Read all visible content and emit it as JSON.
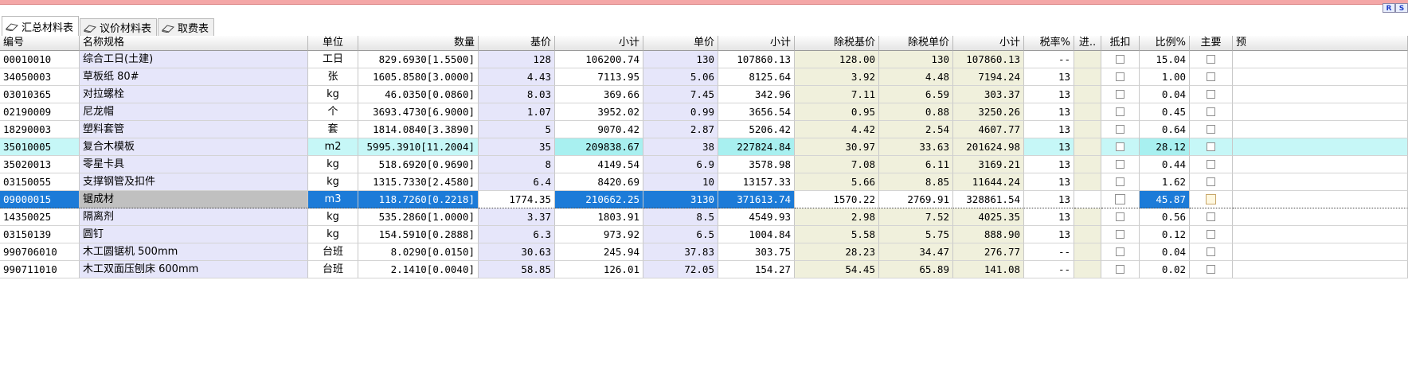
{
  "ribbon_badges": [
    "R",
    "S"
  ],
  "tabs": [
    {
      "label": "汇总材料表",
      "icon": "book-icon",
      "active": true
    },
    {
      "label": "议价材料表",
      "icon": "book-icon",
      "active": false
    },
    {
      "label": "取费表",
      "icon": "book-icon",
      "active": false
    }
  ],
  "columns": [
    "编号",
    "名称规格",
    "单位",
    "数量",
    "基价",
    "小计",
    "单价",
    "小计",
    "除税基价",
    "除税单价",
    "小计",
    "税率%",
    "进..",
    "抵扣",
    "比例%",
    "主要",
    "预"
  ],
  "rows": [
    {
      "code": "00010010",
      "name": "综合工日(土建)",
      "unit": "工日",
      "qty": "829.6930[1.5500]",
      "base_price": "128",
      "subtotal1": "106200.74",
      "unit_price": "130",
      "subtotal2": "107860.13",
      "tax_free_base": "128.00",
      "tax_free_unit": "130",
      "subtotal3": "107860.13",
      "tax_rate": "--",
      "ratio": "15.04"
    },
    {
      "code": "34050003",
      "name": "草板纸 80#",
      "unit": "张",
      "qty": "1605.8580[3.0000]",
      "base_price": "4.43",
      "subtotal1": "7113.95",
      "unit_price": "5.06",
      "subtotal2": "8125.64",
      "tax_free_base": "3.92",
      "tax_free_unit": "4.48",
      "subtotal3": "7194.24",
      "tax_rate": "13",
      "ratio": "1.00"
    },
    {
      "code": "03010365",
      "name": "对拉螺栓",
      "unit": "kg",
      "qty": "46.0350[0.0860]",
      "base_price": "8.03",
      "subtotal1": "369.66",
      "unit_price": "7.45",
      "subtotal2": "342.96",
      "tax_free_base": "7.11",
      "tax_free_unit": "6.59",
      "subtotal3": "303.37",
      "tax_rate": "13",
      "ratio": "0.04"
    },
    {
      "code": "02190009",
      "name": "尼龙帽",
      "unit": "个",
      "qty": "3693.4730[6.9000]",
      "base_price": "1.07",
      "subtotal1": "3952.02",
      "unit_price": "0.99",
      "subtotal2": "3656.54",
      "tax_free_base": "0.95",
      "tax_free_unit": "0.88",
      "subtotal3": "3250.26",
      "tax_rate": "13",
      "ratio": "0.45"
    },
    {
      "code": "18290003",
      "name": "塑料套管",
      "unit": "套",
      "qty": "1814.0840[3.3890]",
      "base_price": "5",
      "subtotal1": "9070.42",
      "unit_price": "2.87",
      "subtotal2": "5206.42",
      "tax_free_base": "4.42",
      "tax_free_unit": "2.54",
      "subtotal3": "4607.77",
      "tax_rate": "13",
      "ratio": "0.64"
    },
    {
      "code": "35010005",
      "name": "复合木模板",
      "unit": "m2",
      "qty": "5995.3910[11.2004]",
      "base_price": "35",
      "subtotal1": "209838.67",
      "unit_price": "38",
      "subtotal2": "227824.84",
      "tax_free_base": "30.97",
      "tax_free_unit": "33.63",
      "subtotal3": "201624.98",
      "tax_rate": "13",
      "ratio": "28.12"
    },
    {
      "code": "35020013",
      "name": "零星卡具",
      "unit": "kg",
      "qty": "518.6920[0.9690]",
      "base_price": "8",
      "subtotal1": "4149.54",
      "unit_price": "6.9",
      "subtotal2": "3578.98",
      "tax_free_base": "7.08",
      "tax_free_unit": "6.11",
      "subtotal3": "3169.21",
      "tax_rate": "13",
      "ratio": "0.44"
    },
    {
      "code": "03150055",
      "name": "支撑钢管及扣件",
      "unit": "kg",
      "qty": "1315.7330[2.4580]",
      "base_price": "6.4",
      "subtotal1": "8420.69",
      "unit_price": "10",
      "subtotal2": "13157.33",
      "tax_free_base": "5.66",
      "tax_free_unit": "8.85",
      "subtotal3": "11644.24",
      "tax_rate": "13",
      "ratio": "1.62"
    },
    {
      "code": "09000015",
      "name": "锯成材",
      "unit": "m3",
      "qty": "118.7260[0.2218]",
      "base_price": "1774.35",
      "subtotal1": "210662.25",
      "unit_price": "3130",
      "subtotal2": "371613.74",
      "tax_free_base": "1570.22",
      "tax_free_unit": "2769.91",
      "subtotal3": "328861.54",
      "tax_rate": "13",
      "ratio": "45.87"
    },
    {
      "code": "14350025",
      "name": "隔离剂",
      "unit": "kg",
      "qty": "535.2860[1.0000]",
      "base_price": "3.37",
      "subtotal1": "1803.91",
      "unit_price": "8.5",
      "subtotal2": "4549.93",
      "tax_free_base": "2.98",
      "tax_free_unit": "7.52",
      "subtotal3": "4025.35",
      "tax_rate": "13",
      "ratio": "0.56"
    },
    {
      "code": "03150139",
      "name": "圆钉",
      "unit": "kg",
      "qty": "154.5910[0.2888]",
      "base_price": "6.3",
      "subtotal1": "973.92",
      "unit_price": "6.5",
      "subtotal2": "1004.84",
      "tax_free_base": "5.58",
      "tax_free_unit": "5.75",
      "subtotal3": "888.90",
      "tax_rate": "13",
      "ratio": "0.12"
    },
    {
      "code": "990706010",
      "name": "木工圆锯机 500mm",
      "unit": "台班",
      "qty": "8.0290[0.0150]",
      "base_price": "30.63",
      "subtotal1": "245.94",
      "unit_price": "37.83",
      "subtotal2": "303.75",
      "tax_free_base": "28.23",
      "tax_free_unit": "34.47",
      "subtotal3": "276.77",
      "tax_rate": "--",
      "ratio": "0.04"
    },
    {
      "code": "990711010",
      "name": "木工双面压刨床 600mm",
      "unit": "台班",
      "qty": "2.1410[0.0040]",
      "base_price": "58.85",
      "subtotal1": "126.01",
      "unit_price": "72.05",
      "subtotal2": "154.27",
      "tax_free_base": "54.45",
      "tax_free_unit": "65.89",
      "subtotal3": "141.08",
      "tax_rate": "--",
      "ratio": "0.02"
    }
  ],
  "selected_row": 8,
  "highlight_row": 5,
  "colors": {
    "selected_bg": "#1c7bd8",
    "lavender": "#e6e6fa",
    "cream": "#f0f0dc",
    "cyan": "#c6f7f7",
    "top_strip": "#f4a7a7"
  }
}
